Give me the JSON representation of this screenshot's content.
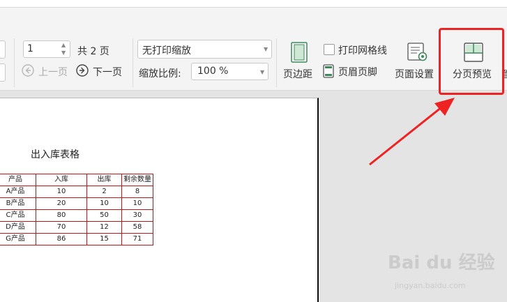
{
  "toolbar": {
    "page_input_value": "1",
    "total_pages": "共 2 页",
    "prev_page": "上一页",
    "next_page": "下一页",
    "scale_mode": "无打印缩放",
    "zoom_label": "缩放比例:",
    "zoom_value": "100 %",
    "margins": "页边距",
    "print_gridlines": "打印网格线",
    "header_footer": "页眉页脚",
    "page_setup": "页面设置",
    "page_break_preview": "分页预览",
    "cut_char": "管"
  },
  "sheet": {
    "title": "出入库表格",
    "headers": [
      "产品",
      "入库",
      "出库",
      "剩余数量"
    ],
    "rows": [
      [
        "A产品",
        "10",
        "2",
        "8"
      ],
      [
        "B产品",
        "20",
        "10",
        "10"
      ],
      [
        "C产品",
        "80",
        "50",
        "30"
      ],
      [
        "D产品",
        "70",
        "12",
        "58"
      ],
      [
        "G产品",
        "86",
        "15",
        "71"
      ]
    ]
  },
  "watermark": {
    "brand": "Bai du 经验",
    "url": "jingyan.baidu.com"
  },
  "colors": {
    "highlight": "#ee2222",
    "table_border": "#b31b1b"
  }
}
